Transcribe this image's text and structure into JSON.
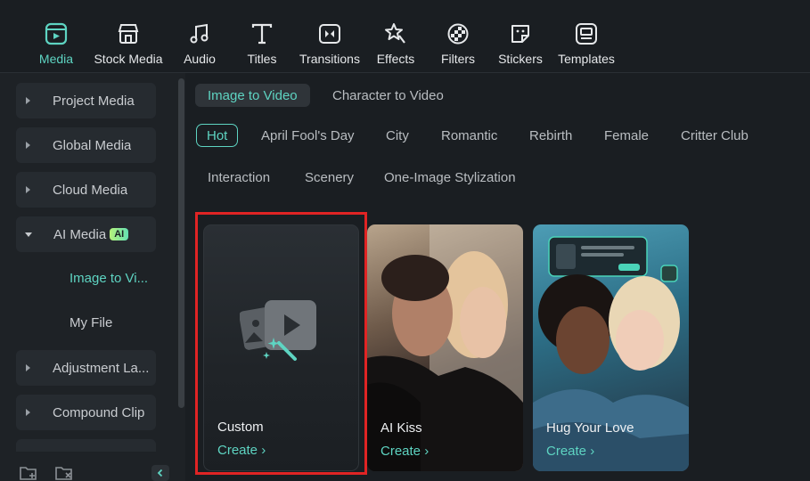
{
  "toolbar": {
    "items": [
      {
        "label": "Media",
        "icon": "media-icon",
        "active": true
      },
      {
        "label": "Stock Media",
        "icon": "stock-media-icon"
      },
      {
        "label": "Audio",
        "icon": "music-note-icon"
      },
      {
        "label": "Titles",
        "icon": "titles-icon"
      },
      {
        "label": "Transitions",
        "icon": "transitions-icon"
      },
      {
        "label": "Effects",
        "icon": "effects-icon"
      },
      {
        "label": "Filters",
        "icon": "filters-icon"
      },
      {
        "label": "Stickers",
        "icon": "stickers-icon"
      },
      {
        "label": "Templates",
        "icon": "templates-icon"
      }
    ]
  },
  "sidebar": {
    "items": [
      {
        "label": "Project Media"
      },
      {
        "label": "Global Media"
      },
      {
        "label": "Cloud Media"
      },
      {
        "label": "AI Media",
        "badge": "AI",
        "expanded": true
      },
      {
        "label": "Adjustment La..."
      },
      {
        "label": "Compound Clip"
      }
    ],
    "subitems": [
      {
        "label": "Image to Vi...",
        "active": true
      },
      {
        "label": "My File"
      }
    ]
  },
  "main": {
    "tabs": [
      {
        "label": "Image to Video",
        "active": true
      },
      {
        "label": "Character to Video"
      }
    ],
    "categories": [
      {
        "label": "Hot",
        "active": true
      },
      {
        "label": "April Fool's Day"
      },
      {
        "label": "City"
      },
      {
        "label": "Romantic"
      },
      {
        "label": "Rebirth"
      },
      {
        "label": "Female"
      },
      {
        "label": "Critter Club"
      },
      {
        "label": "Interaction"
      },
      {
        "label": "Scenery"
      },
      {
        "label": "One-Image Stylization"
      }
    ],
    "cards": [
      {
        "title": "Custom",
        "action": "Create"
      },
      {
        "title": "AI Kiss",
        "action": "Create"
      },
      {
        "title": "Hug Your Love",
        "action": "Create"
      }
    ]
  },
  "colors": {
    "accent": "#5ed4c2",
    "highlight": "#e02424"
  }
}
